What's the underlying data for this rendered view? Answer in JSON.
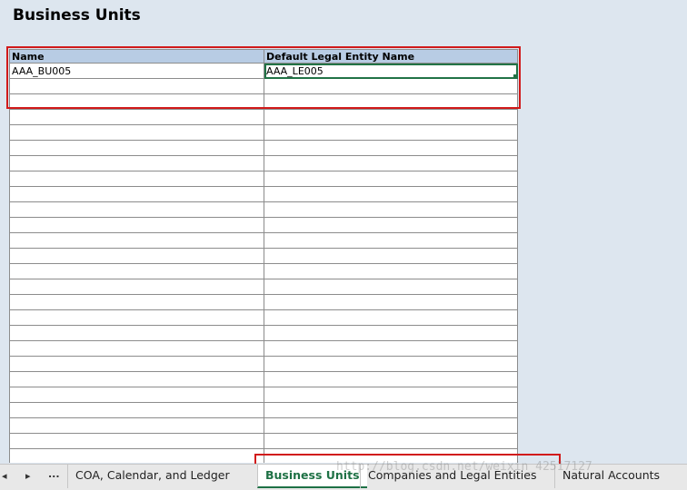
{
  "sheet": {
    "title": "Business Units",
    "columns": [
      "Name",
      "Default Legal Entity Name"
    ],
    "rows": [
      [
        "AAA_BU005",
        "AAA_LE005"
      ]
    ],
    "empty_row_count": 25
  },
  "tabs": {
    "nav_prev": "◂",
    "nav_next": "▸",
    "more": "...",
    "items": [
      {
        "label": "COA, Calendar, and Ledger",
        "active": false
      },
      {
        "label": "Business Units",
        "active": true
      },
      {
        "label": "Companies and Legal Entities",
        "active": false
      },
      {
        "label": "Natural Accounts",
        "active": false
      }
    ]
  },
  "watermark": "http://blog.csdn.net/weixin_42517127",
  "colors": {
    "header_fill": "#b8cce4",
    "active_tab_text": "#1e7145",
    "highlight_box": "#d11a1a",
    "background": "#dde6ef"
  }
}
